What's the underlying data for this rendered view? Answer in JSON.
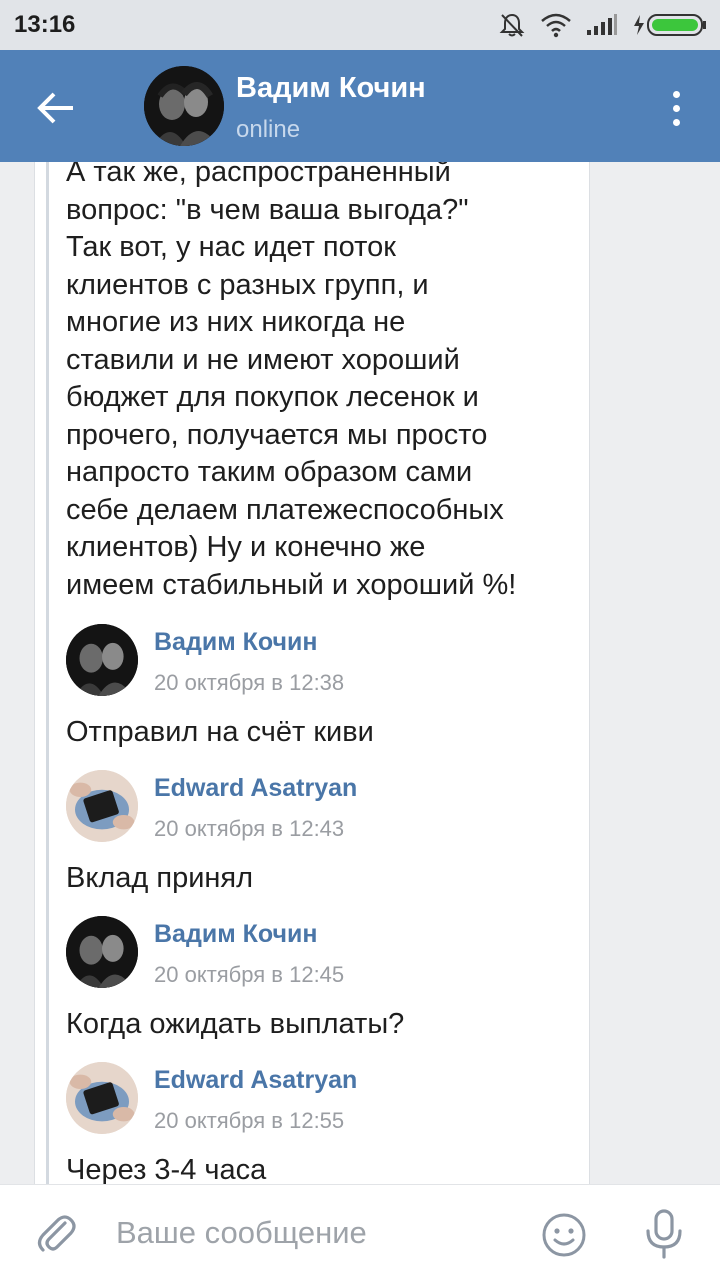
{
  "statusbar": {
    "time": "13:16"
  },
  "header": {
    "contact_name": "Вадим Кочин",
    "contact_status": "online"
  },
  "conversation": {
    "forwarded_text": "А так же, распространенный вопрос: \"в чем ваша выгода?\" Так вот, у нас идет поток клиентов с разных групп, и многие из них никогда не ставили и не имеют хороший бюджет для покупок лесенок и прочего, получается мы просто напросто таким образом сами себе делаем платежеспособных клиентов) Ну и конечно же имеем стабильный и хороший %!",
    "forwarded_lines": [
      "А так же, распространенный",
      "вопрос: \"в чем ваша выгода?\"",
      "Так вот, у нас идет поток",
      "клиентов с разных групп, и",
      "многие из них никогда не",
      "ставили и не имеют хороший",
      "бюджет для покупок лесенок и",
      "прочего, получается мы просто",
      "напросто таким образом сами",
      "себе делаем платежеспособных",
      "клиентов) Ну и конечно же",
      "имеем стабильный и хороший %!"
    ],
    "messages": [
      {
        "author": "Вадим Кочин",
        "date": "20 октября в 12:38",
        "text": "Отправил на счёт киви"
      },
      {
        "author": "Edward Asatryan",
        "date": "20 октября в 12:43",
        "text": "Вклад принял"
      },
      {
        "author": "Вадим Кочин",
        "date": "20 октября в 12:45",
        "text": "Когда ожидать выплаты?"
      },
      {
        "author": "Edward Asatryan",
        "date": "20 октября в 12:55",
        "text": "Через 3-4 часа"
      }
    ]
  },
  "input": {
    "placeholder": "Ваше сообщение"
  },
  "colors": {
    "header_bg": "#5181b8",
    "author_link": "#4a76a8",
    "chat_bg": "#edeef0"
  },
  "icons": [
    "back-arrow-icon",
    "menu-dots-icon",
    "mute-bell-icon",
    "wifi-icon",
    "signal-icon",
    "battery-charging-icon",
    "attach-clip-icon",
    "emoji-icon",
    "microphone-icon"
  ]
}
